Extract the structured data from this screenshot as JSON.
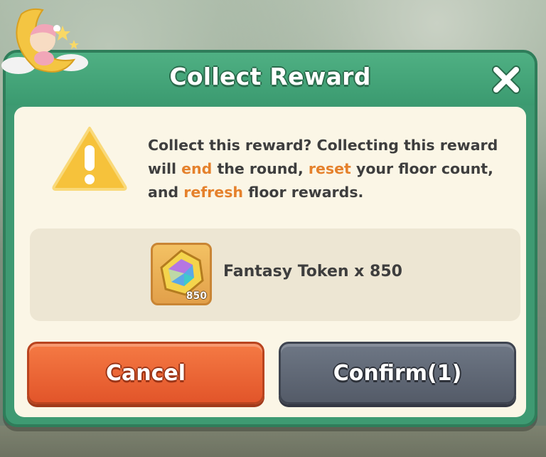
{
  "dialog": {
    "title": "Collect Reward",
    "message": {
      "part1": "Collect this reward? Collecting this reward will ",
      "hl1": "end",
      "part2": " the round, ",
      "hl2": "reset",
      "part3": " your floor count, and ",
      "hl3": "refresh",
      "part4": " floor rewards."
    },
    "reward": {
      "icon": "fantasy-token-icon",
      "badge_count": "850",
      "label": "Fantasy Token x 850"
    },
    "buttons": {
      "cancel": "Cancel",
      "confirm": "Confirm(1)"
    }
  },
  "colors": {
    "header_green": "#3e9a72",
    "highlight_orange": "#e5812c",
    "cancel_orange": "#e85f30",
    "confirm_gray": "#5e6674",
    "panel_cream": "#fbf6e6"
  }
}
